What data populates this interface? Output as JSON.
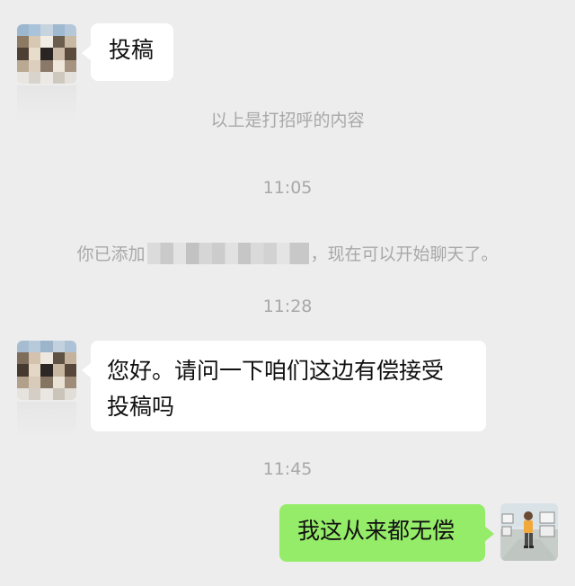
{
  "messages": {
    "first_incoming": "投稿",
    "greeting_note": "以上是打招呼的内容",
    "time_1": "11:05",
    "added_prefix": "你已添加",
    "added_suffix": "，现在可以开始聊天了。",
    "time_2": "11:28",
    "second_incoming_line1": "您好。请问一下咱们这边有偿接受",
    "second_incoming_line2": "投稿吗",
    "time_3": "11:45",
    "outgoing": "我这从来都无偿"
  },
  "colors": {
    "background": "#ededed",
    "incoming_bubble": "#ffffff",
    "outgoing_bubble": "#95ec69",
    "system_text": "#a8a8a8"
  },
  "icons": {
    "contact_avatar": "pixelated-avatar-icon",
    "self_avatar": "user-avatar-icon"
  }
}
